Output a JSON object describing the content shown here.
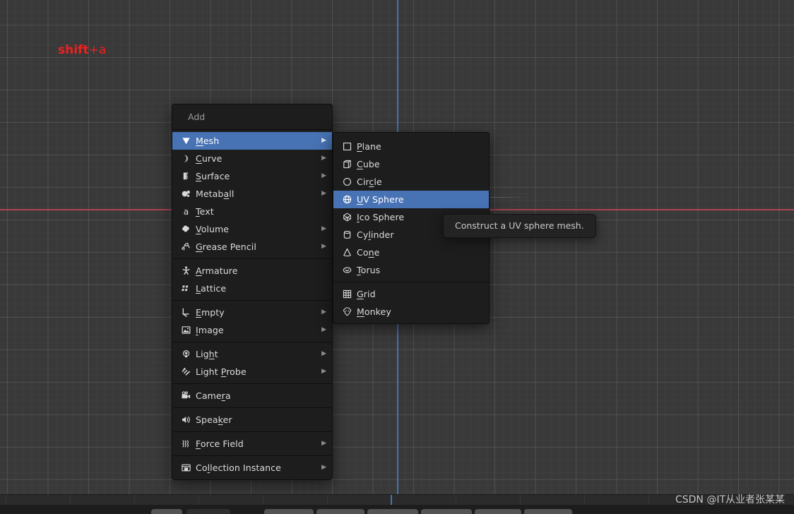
{
  "annotation": {
    "hotkey_bold": "shift",
    "hotkey_rest": "+a",
    "color": "#f01f1f"
  },
  "viewport": {
    "background_color": "#393939",
    "grid_major_color": "#4a4a4a",
    "x_axis_color": "#ac4552",
    "y_axis_color": "#4772b3"
  },
  "add_menu": {
    "title": "Add",
    "accent_color": "#4772b3",
    "groups": [
      {
        "items": [
          {
            "label": "Mesh",
            "icon": "mesh-icon",
            "underline_index": 0,
            "submenu": true,
            "selected": true
          },
          {
            "label": "Curve",
            "icon": "curve-icon",
            "underline_index": 0,
            "submenu": true,
            "selected": false
          },
          {
            "label": "Surface",
            "icon": "surface-icon",
            "underline_index": 0,
            "submenu": true,
            "selected": false
          },
          {
            "label": "Metaball",
            "icon": "metaball-icon",
            "underline_index": 5,
            "submenu": true,
            "selected": false
          },
          {
            "label": "Text",
            "icon": "text-icon",
            "underline_index": 0,
            "submenu": false,
            "selected": false
          },
          {
            "label": "Volume",
            "icon": "volume-icon",
            "underline_index": 0,
            "submenu": true,
            "selected": false
          },
          {
            "label": "Grease Pencil",
            "icon": "grease-pencil-icon",
            "underline_index": 0,
            "submenu": true,
            "selected": false
          }
        ]
      },
      {
        "items": [
          {
            "label": "Armature",
            "icon": "armature-icon",
            "underline_index": 0,
            "submenu": false,
            "selected": false
          },
          {
            "label": "Lattice",
            "icon": "lattice-icon",
            "underline_index": 0,
            "submenu": false,
            "selected": false
          }
        ]
      },
      {
        "items": [
          {
            "label": "Empty",
            "icon": "empty-icon",
            "underline_index": 0,
            "submenu": true,
            "selected": false
          },
          {
            "label": "Image",
            "icon": "image-icon",
            "underline_index": 0,
            "submenu": true,
            "selected": false
          }
        ]
      },
      {
        "items": [
          {
            "label": "Light",
            "icon": "light-icon",
            "underline_index": 3,
            "submenu": true,
            "selected": false
          },
          {
            "label": "Light Probe",
            "icon": "light-probe-icon",
            "underline_index": 6,
            "submenu": true,
            "selected": false
          }
        ]
      },
      {
        "items": [
          {
            "label": "Camera",
            "icon": "camera-icon",
            "underline_index": 4,
            "submenu": false,
            "selected": false
          }
        ]
      },
      {
        "items": [
          {
            "label": "Speaker",
            "icon": "speaker-icon",
            "underline_index": 4,
            "submenu": false,
            "selected": false
          }
        ]
      },
      {
        "items": [
          {
            "label": "Force Field",
            "icon": "force-field-icon",
            "underline_index": 0,
            "submenu": true,
            "selected": false
          }
        ]
      },
      {
        "items": [
          {
            "label": "Collection Instance",
            "icon": "collection-instance-icon",
            "underline_index": 2,
            "submenu": true,
            "selected": false
          }
        ]
      }
    ]
  },
  "mesh_submenu": {
    "groups": [
      {
        "items": [
          {
            "label": "Plane",
            "icon": "plane-icon",
            "underline_index": 0,
            "selected": false
          },
          {
            "label": "Cube",
            "icon": "cube-icon",
            "underline_index": 0,
            "selected": false
          },
          {
            "label": "Circle",
            "icon": "circle-icon",
            "underline_index": 3,
            "selected": false
          },
          {
            "label": "UV Sphere",
            "icon": "uv-sphere-icon",
            "underline_index": 0,
            "selected": true
          },
          {
            "label": "Ico Sphere",
            "icon": "ico-sphere-icon",
            "underline_index": 0,
            "selected": false
          },
          {
            "label": "Cylinder",
            "icon": "cylinder-icon",
            "underline_index": 2,
            "selected": false
          },
          {
            "label": "Cone",
            "icon": "cone-icon",
            "underline_index": 2,
            "selected": false
          },
          {
            "label": "Torus",
            "icon": "torus-icon",
            "underline_index": 0,
            "selected": false
          }
        ]
      },
      {
        "items": [
          {
            "label": "Grid",
            "icon": "grid-icon",
            "underline_index": 0,
            "selected": false
          },
          {
            "label": "Monkey",
            "icon": "monkey-icon",
            "underline_index": 0,
            "selected": false
          }
        ]
      }
    ]
  },
  "tooltip": {
    "text": "Construct a UV sphere mesh."
  },
  "watermark": {
    "text": "CSDN @IT从业者张某某"
  }
}
